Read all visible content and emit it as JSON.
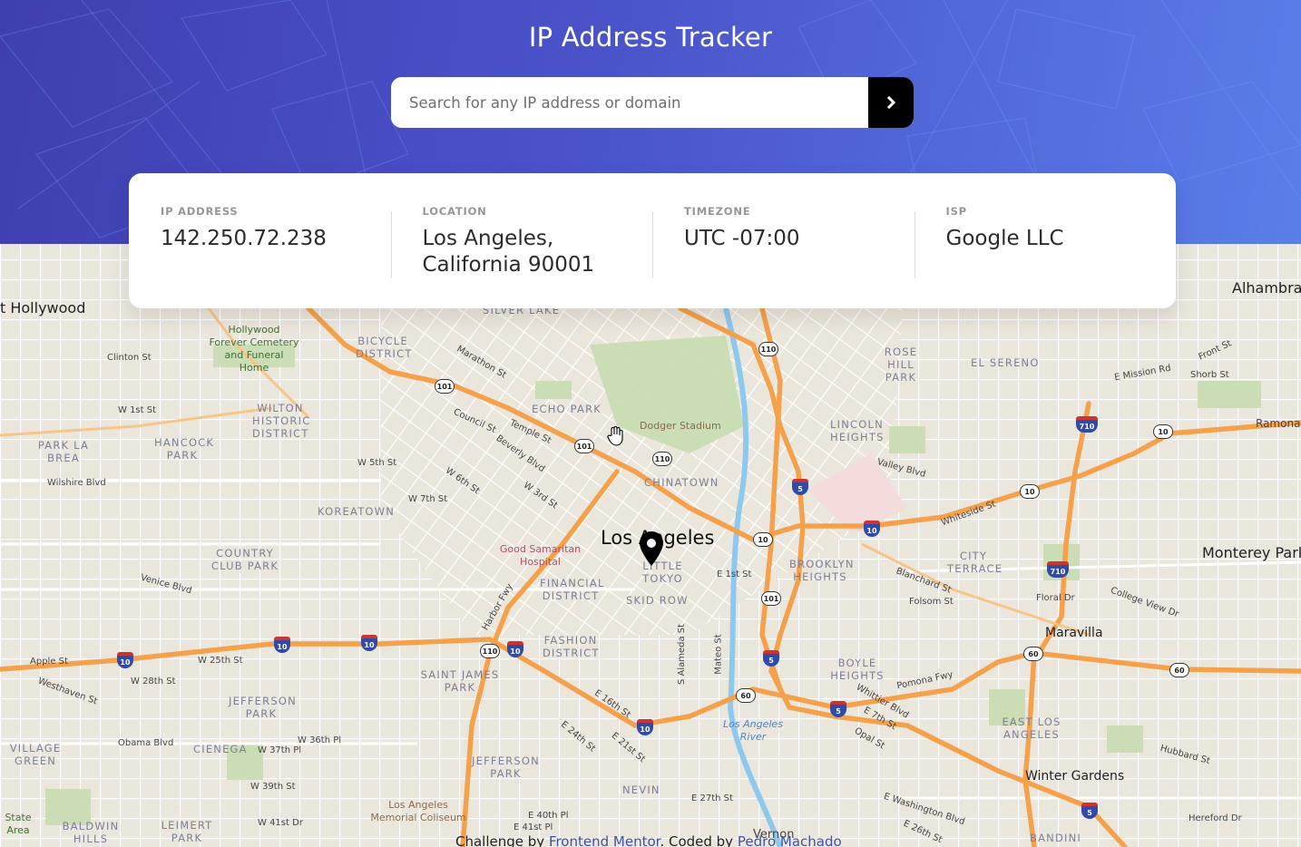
{
  "header": {
    "title": "IP Address Tracker",
    "search_placeholder": "Search for any IP address or domain",
    "search_value": "",
    "submit_icon": "chevron-right-icon"
  },
  "info": [
    {
      "label": "IP ADDRESS",
      "value": "142.250.72.238"
    },
    {
      "label": "LOCATION",
      "value": "Los Angeles, California 90001"
    },
    {
      "label": "TIMEZONE",
      "value": "UTC -07:00"
    },
    {
      "label": "ISP",
      "value": "Google LLC"
    }
  ],
  "map": {
    "city": "Los Angeles",
    "districts": [
      "BICYCLE DISTRICT",
      "ECHO PARK",
      "WILTON HISTORIC DISTRICT",
      "PARK LA BREA",
      "HANCOCK PARK",
      "KOREATOWN",
      "COUNTRY CLUB PARK",
      "CHINATOWN",
      "LITTLE TOKYO",
      "SKID ROW",
      "FINANCIAL DISTRICT",
      "FASHION DISTRICT",
      "SAINT JAMES PARK",
      "JEFFERSON PARK",
      "VILLAGE GREEN",
      "CIENEGA",
      "JEFFERSON PARK",
      "NEVIN",
      "BALDWIN HILLS",
      "LEIMERT PARK",
      "ROSE HILL PARK",
      "EL SERENO",
      "LINCOLN HEIGHTS",
      "BROOKLYN HEIGHTS",
      "CITY TERRACE",
      "BOYLE HEIGHTS",
      "EAST LOS ANGELES",
      "SILVER LAKE",
      "BANDINI"
    ],
    "areas": [
      "Alhambra",
      "Monterey Park",
      "Maravilla",
      "Winter Gardens",
      "t Hollywood"
    ],
    "parks": [
      "Hollywood Forever Cemetery and Funeral Home",
      "Dodger Stadium",
      "Good Samaritan Hospital",
      "Los Angeles Memorial Coliseum",
      "State Area"
    ],
    "water": "Los Angeles River",
    "streets": [
      "Clinton St",
      "W 1st St",
      "W 5th St",
      "W 7th St",
      "W 6th St",
      "W 3rd St",
      "Wilshire Blvd",
      "Beverly Blvd",
      "Temple St",
      "Council St",
      "Marathon St",
      "Venice Blvd",
      "W 25th St",
      "W 28th St",
      "Westhaven St",
      "Apple St",
      "Obama Blvd",
      "W 37th Pl",
      "W 36th Pl",
      "W 39th St",
      "W 41st Dr",
      "E 40th Pl",
      "E 41st Pl",
      "E 27th St",
      "E 1st St",
      "Valley Blvd",
      "Whiteside St",
      "Blanchard St",
      "Folsom St",
      "Floral Dr",
      "College View Dr",
      "Pomona Fwy",
      "Whittier Blvd",
      "E 7th St",
      "Opal St",
      "E Washington Blvd",
      "E 26th St",
      "Hubbard St",
      "Hereford Dr",
      "E Mission Rd",
      "Front St",
      "Shorb St",
      "Ramona",
      "Harbor Fwy",
      "E 16th St",
      "E 24th St",
      "E 21st St",
      "Vernon",
      "S Alameda St",
      "Mateo St"
    ],
    "shields": [
      "101",
      "110",
      "10",
      "5",
      "60",
      "710"
    ]
  },
  "footer": {
    "prefix": "Challenge by ",
    "link1": "Frontend Mentor",
    "middle": ". Coded by ",
    "link2": "Pedro Machado"
  },
  "colors": {
    "header_start": "#3f3fb0",
    "header_end": "#5a7ee8",
    "button": "#000000",
    "label": "#969696",
    "value": "#2b2b2b",
    "highway": "#f5a04a",
    "map_bg": "#ebe6dc"
  }
}
